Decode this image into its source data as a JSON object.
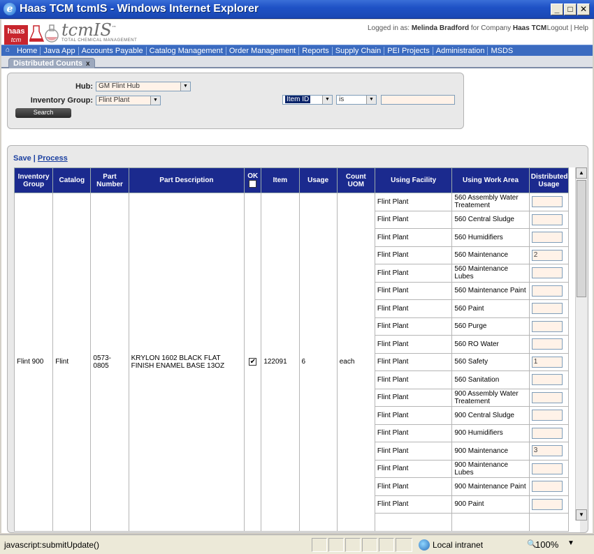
{
  "window": {
    "title": "Haas TCM tcmIS - Windows Internet Explorer"
  },
  "header": {
    "logo_text": "haas",
    "logo_sub": "tcm",
    "brand": "tcmIS",
    "brand_tm": "™",
    "brand_tagline": "TOTAL CHEMICAL MANAGEMENT",
    "logged_in_prefix": "Logged in as:",
    "user": "Melinda Bradford",
    "company_prefix": "for Company",
    "company": "Haas TCM",
    "logout": "Logout",
    "help": "Help"
  },
  "nav": [
    "Home",
    "Java App",
    "Accounts Payable",
    "Catalog Management",
    "Order Management",
    "Reports",
    "Supply Chain",
    "PEI Projects",
    "Administration",
    "MSDS"
  ],
  "tabs": [
    {
      "label": "Distributed Counts",
      "close": "x"
    }
  ],
  "search": {
    "hub_label": "Hub:",
    "hub_value": "GM Flint Hub",
    "inventory_group_label": "Inventory Group:",
    "inventory_group_value": "Flint Plant",
    "field_value": "Item ID",
    "operator_value": "is",
    "search_text": "",
    "search_button": "Search"
  },
  "results": {
    "save": "Save",
    "separator": "|",
    "process": "Process",
    "columns": [
      "Inventory Group",
      "Catalog",
      "Part Number",
      "Part Description",
      "OK",
      "Item",
      "Usage",
      "Count UOM",
      "Using Facility",
      "Using Work Area",
      "Distributed Usage"
    ],
    "row": {
      "inventory_group": "Flint 900",
      "catalog": "Flint",
      "part_number": "0573-0805",
      "part_description": "KRYLON 1602 BLACK FLAT FINISH ENAMEL BASE 13OZ",
      "ok_checked": true,
      "item": "122091",
      "usage": "6",
      "count_uom": "each"
    },
    "sub_rows": [
      {
        "facility": "Flint Plant",
        "work_area": "560 Assembly Water Treatement",
        "distributed_usage": ""
      },
      {
        "facility": "Flint Plant",
        "work_area": "560 Central Sludge",
        "distributed_usage": ""
      },
      {
        "facility": "Flint Plant",
        "work_area": "560 Humidifiers",
        "distributed_usage": ""
      },
      {
        "facility": "Flint Plant",
        "work_area": "560 Maintenance",
        "distributed_usage": "2"
      },
      {
        "facility": "Flint Plant",
        "work_area": "560 Maintenance Lubes",
        "distributed_usage": ""
      },
      {
        "facility": "Flint Plant",
        "work_area": "560 Maintenance Paint",
        "distributed_usage": ""
      },
      {
        "facility": "Flint Plant",
        "work_area": "560 Paint",
        "distributed_usage": ""
      },
      {
        "facility": "Flint Plant",
        "work_area": "560 Purge",
        "distributed_usage": ""
      },
      {
        "facility": "Flint Plant",
        "work_area": "560 RO Water",
        "distributed_usage": ""
      },
      {
        "facility": "Flint Plant",
        "work_area": "560 Safety",
        "distributed_usage": "1"
      },
      {
        "facility": "Flint Plant",
        "work_area": "560 Sanitation",
        "distributed_usage": ""
      },
      {
        "facility": "Flint Plant",
        "work_area": "900 Assembly Water Treatement",
        "distributed_usage": ""
      },
      {
        "facility": "Flint Plant",
        "work_area": "900 Central Sludge",
        "distributed_usage": ""
      },
      {
        "facility": "Flint Plant",
        "work_area": "900 Humidifiers",
        "distributed_usage": ""
      },
      {
        "facility": "Flint Plant",
        "work_area": "900 Maintenance",
        "distributed_usage": "3"
      },
      {
        "facility": "Flint Plant",
        "work_area": "900 Maintenance Lubes",
        "distributed_usage": ""
      },
      {
        "facility": "Flint Plant",
        "work_area": "900 Maintenance Paint",
        "distributed_usage": ""
      },
      {
        "facility": "Flint Plant",
        "work_area": "900 Paint",
        "distributed_usage": ""
      },
      {
        "facility": "",
        "work_area": "",
        "distributed_usage": ""
      }
    ]
  },
  "statusbar": {
    "text": "javascript:submitUpdate()",
    "zone": "Local intranet",
    "zoom": "100%"
  },
  "colors": {
    "title_bar": "#1f52c6",
    "nav_bar": "#3b6bc0",
    "grid_header": "#1b2a8e",
    "input_fill": "#fff2e8",
    "logo_red": "#c8262e"
  }
}
